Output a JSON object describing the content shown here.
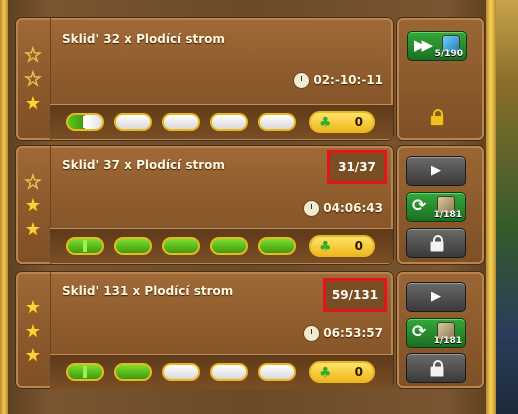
{
  "rows": [
    {
      "title": "Sklid' 32 x Plodící strom",
      "timer": "02:-10:-11",
      "stars": [
        "empty",
        "empty",
        "filled"
      ],
      "reward": "0",
      "action_label": "5/190",
      "action_button": "fast-forward"
    },
    {
      "title": "Sklid' 37 x Plodící strom",
      "count": "31/37",
      "timer": "04:06:43",
      "stars": [
        "empty",
        "filled",
        "filled"
      ],
      "reward": "0",
      "refresh_count": "1/181"
    },
    {
      "title": "Sklid' 131 x Plodící strom",
      "count": "59/131",
      "timer": "06:53:57",
      "stars": [
        "filled",
        "filled",
        "filled"
      ],
      "reward": "0",
      "refresh_count": "1/181"
    }
  ],
  "icons": {
    "star": "star-icon",
    "clock": "clock-icon",
    "clover": "clover-icon",
    "lock": "lock-icon",
    "play": "play-icon",
    "refresh": "refresh-icon",
    "fast_forward": "fast-forward-icon"
  },
  "colors": {
    "highlight_red": "#e8121a",
    "gold": "#e8b820",
    "green_button": "#2a8a30"
  }
}
